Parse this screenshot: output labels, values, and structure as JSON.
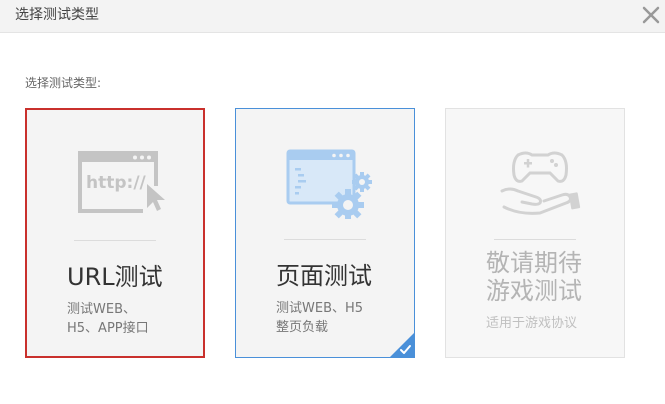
{
  "dialog": {
    "title": "选择测试类型",
    "prompt": "选择测试类型:"
  },
  "cards": [
    {
      "title": "URL测试",
      "desc_line1": "测试WEB、",
      "desc_line2": "H5、APP接口",
      "icon": "browser-http-cursor-icon",
      "state": "hovered"
    },
    {
      "title": "页面测试",
      "desc_line1": "测试WEB、H5",
      "desc_line2": "整页负载",
      "icon": "browser-settings-gears-icon",
      "state": "selected"
    },
    {
      "title_line1": "敬请期待",
      "title_line2": "游戏测试",
      "desc": "适用于游戏协议",
      "icon": "gamepad-hand-icon",
      "state": "disabled"
    }
  ],
  "colors": {
    "hover_border": "#c9302c",
    "selected_border": "#4a90d9",
    "icon_gray": "#c4c4c4",
    "icon_blue": "#a9ccf0"
  }
}
